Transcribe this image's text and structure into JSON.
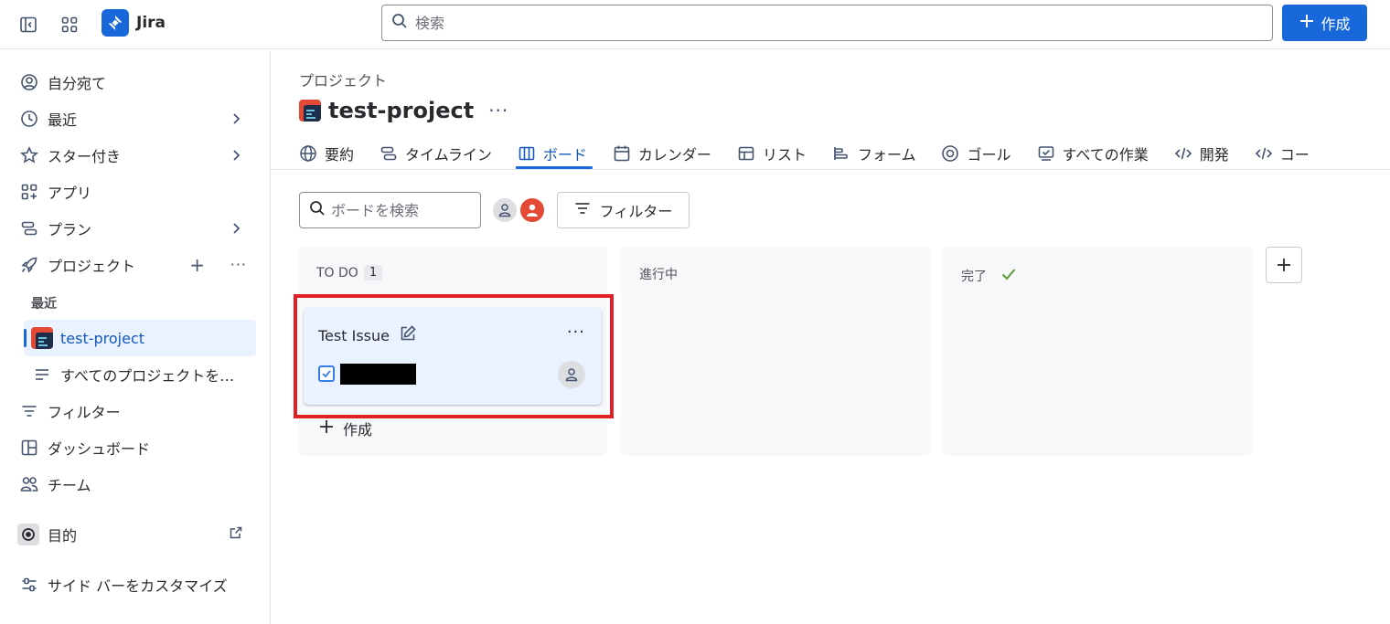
{
  "topbar": {
    "app_name": "Jira",
    "search_placeholder": "検索",
    "create_label": "作成"
  },
  "sidebar": {
    "items": {
      "assigned": "自分宛て",
      "recent": "最近",
      "starred": "スター付き",
      "apps": "アプリ",
      "plans": "プラン",
      "projects": "プロジェクト",
      "filters": "フィルター",
      "dashboards": "ダッシュボード",
      "teams": "チーム",
      "goals": "目的",
      "customize": "サイド バーをカスタマイズ"
    },
    "recent_section": "最近",
    "active_project": "test-project",
    "all_projects": "すべてのプロジェクトを…"
  },
  "main": {
    "breadcrumb": "プロジェクト",
    "project_title": "test-project",
    "tabs": {
      "summary": "要約",
      "timeline": "タイムライン",
      "board": "ボード",
      "calendar": "カレンダー",
      "list": "リスト",
      "forms": "フォーム",
      "goals": "ゴール",
      "all_work": "すべての作業",
      "development": "開発",
      "code": "コー"
    },
    "board_search_placeholder": "ボードを検索",
    "filter_label": "フィルター",
    "columns": {
      "todo": {
        "title": "TO DO",
        "count": "1"
      },
      "in_progress": {
        "title": "進行中"
      },
      "done": {
        "title": "完了"
      }
    },
    "card": {
      "title": "Test Issue"
    },
    "column_create_label": "作成"
  },
  "colors": {
    "brand": "#1868db",
    "active_bg": "#e9f2fe",
    "highlight_frame": "#e21f26",
    "project_icon": "#e34935",
    "done_check": "#5b9c36"
  }
}
